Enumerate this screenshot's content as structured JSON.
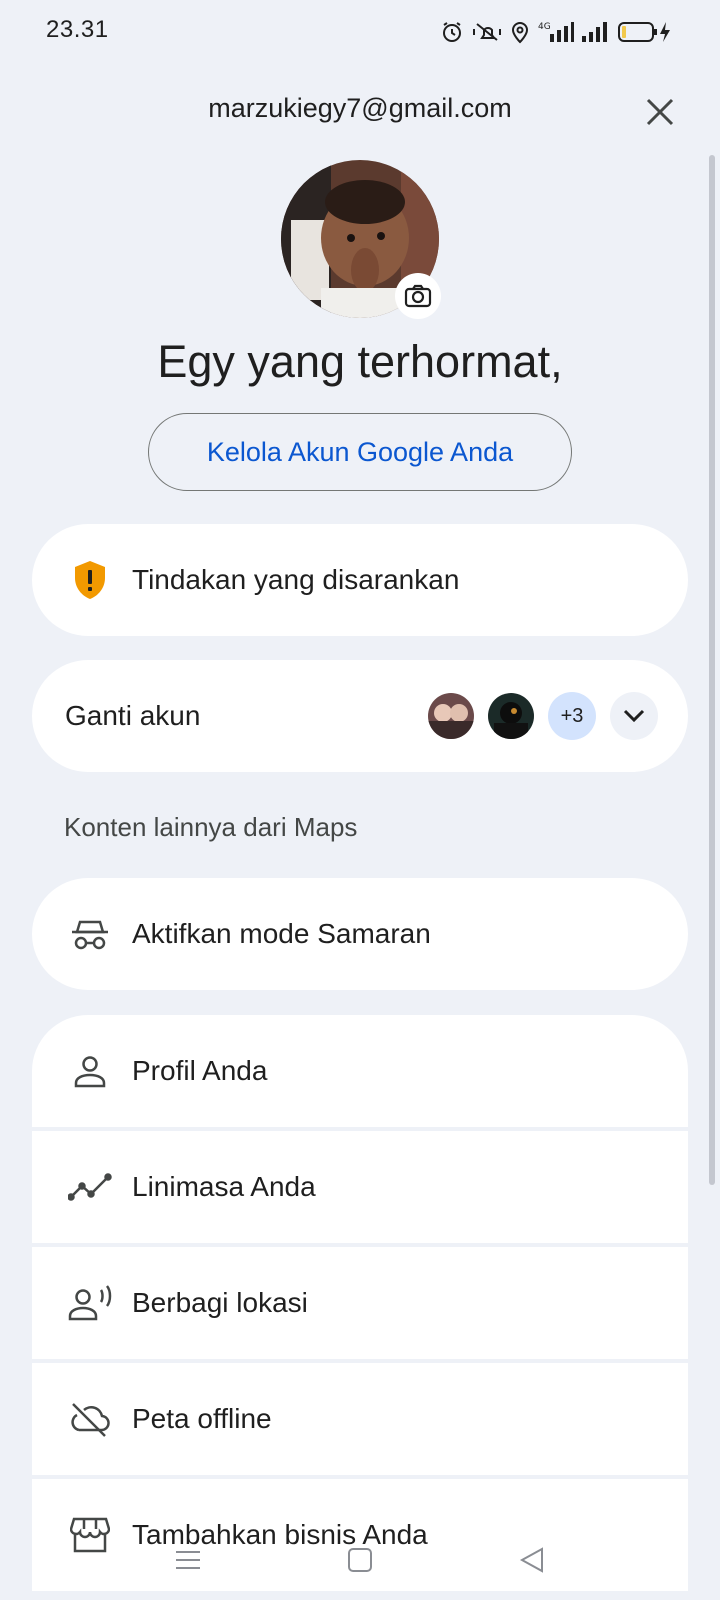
{
  "status_bar": {
    "time": "23.31",
    "icons": [
      "alarm-icon",
      "mute-vibrate-icon",
      "location-icon",
      "4g-signal-icon",
      "signal-icon",
      "battery-charging-icon"
    ]
  },
  "header": {
    "email": "marzukiegy7@gmail.com",
    "close_icon": "close-icon"
  },
  "profile": {
    "greeting": "Egy yang terhormat,",
    "manage_button": "Kelola Akun Google Anda",
    "camera_icon": "camera-icon"
  },
  "suggested_action": {
    "label": "Tindakan yang disarankan",
    "icon": "warning-shield-icon",
    "icon_color": "#f29900"
  },
  "switch_account": {
    "label": "Ganti akun",
    "more_count": "+3",
    "expand_icon": "chevron-down-icon"
  },
  "section": {
    "label": "Konten lainnya dari Maps"
  },
  "incognito": {
    "label": "Aktifkan mode Samaran",
    "icon": "incognito-icon"
  },
  "menu": {
    "items": [
      {
        "label": "Profil Anda",
        "icon": "person-icon"
      },
      {
        "label": "Linimasa Anda",
        "icon": "timeline-icon"
      },
      {
        "label": "Berbagi lokasi",
        "icon": "location-sharing-icon"
      },
      {
        "label": "Peta offline",
        "icon": "offline-cloud-icon"
      },
      {
        "label": "Tambahkan bisnis Anda",
        "icon": "storefront-icon"
      }
    ]
  },
  "colors": {
    "background": "#eef1f7",
    "accent": "#0b57d0",
    "card": "#ffffff",
    "badge": "#d3e3fd"
  }
}
